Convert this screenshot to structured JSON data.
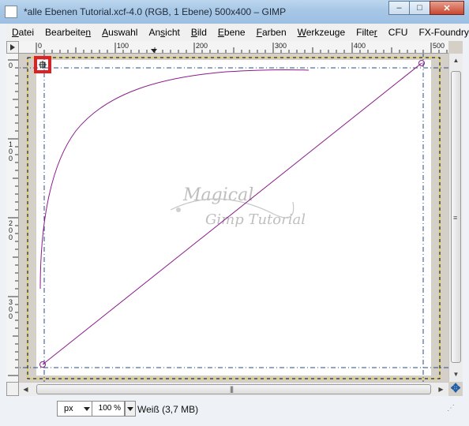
{
  "window": {
    "title": "*alle Ebenen Tutorial.xcf-4.0 (RGB, 1 Ebene) 500x400 – GIMP",
    "minimize_glyph": "–",
    "maximize_glyph": "□",
    "close_glyph": "✕"
  },
  "menubar": {
    "items": [
      {
        "pre": "",
        "u": "D",
        "post": "atei"
      },
      {
        "pre": "Bearbeite",
        "u": "n",
        "post": ""
      },
      {
        "pre": "",
        "u": "A",
        "post": "uswahl"
      },
      {
        "pre": "An",
        "u": "s",
        "post": "icht"
      },
      {
        "pre": "",
        "u": "B",
        "post": "ild"
      },
      {
        "pre": "",
        "u": "E",
        "post": "bene"
      },
      {
        "pre": "",
        "u": "F",
        "post": "arben"
      },
      {
        "pre": "",
        "u": "W",
        "post": "erkzeuge"
      },
      {
        "pre": "Filte",
        "u": "r",
        "post": ""
      },
      {
        "pre": "CFU",
        "u": "",
        "post": ""
      },
      {
        "pre": "FX-Foundry",
        "u": "",
        "post": ""
      }
    ]
  },
  "rulers": {
    "horizontal": [
      "0",
      "100",
      "200",
      "300",
      "400",
      "500"
    ],
    "vertical": [
      "0",
      "100",
      "200",
      "300"
    ]
  },
  "canvas": {
    "watermark_line1": "Magical",
    "watermark_line2": "Gimp Tutorial",
    "path_color": "#8a1a8a",
    "guide_color": "#2a4a8a",
    "highlight_color": "#e02020"
  },
  "statusbar": {
    "unit": "px",
    "zoom": "100 %",
    "info": "Weiß (3,7 MB)"
  }
}
